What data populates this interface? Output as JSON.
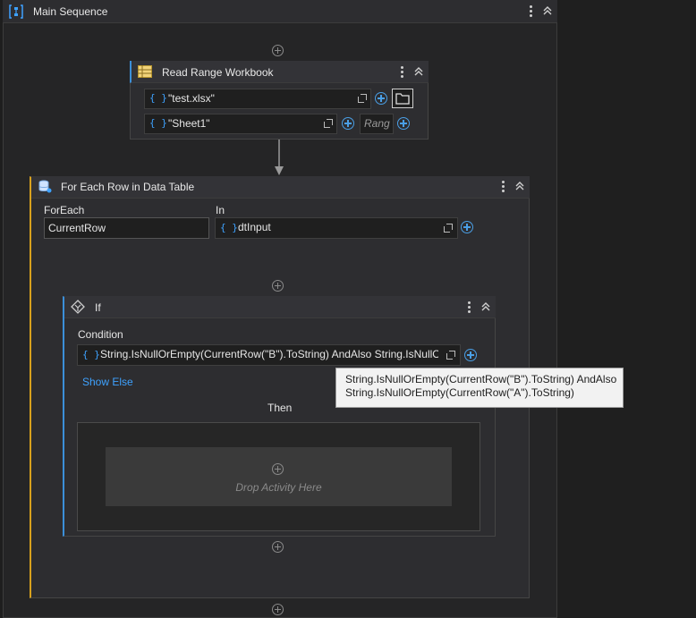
{
  "sequence": {
    "title": "Main Sequence"
  },
  "read_range": {
    "title": "Read Range Workbook",
    "workbook_path": "\"test.xlsx\"",
    "sheet_name": "\"Sheet1\"",
    "range_placeholder": "Rang"
  },
  "for_each": {
    "title": "For Each Row in Data Table",
    "foreach_label": "ForEach",
    "foreach_value": "CurrentRow",
    "in_label": "In",
    "in_value": "dtInput"
  },
  "if_activity": {
    "title": "If",
    "condition_label": "Condition",
    "condition_value": "String.IsNullOrEmpty(CurrentRow(\"B\").ToString) AndAlso String.IsNullO",
    "show_else": "Show Else",
    "then_label": "Then",
    "drop_hint": "Drop Activity Here"
  },
  "tooltip": {
    "line1": "String.IsNullOrEmpty(CurrentRow(\"B\").ToString) AndAlso",
    "line2": "String.IsNullOrEmpty(CurrentRow(\"A\").ToString)"
  },
  "colors": {
    "accent_blue": "#3ea2ff",
    "foreach_accent": "#d8a11d",
    "if_accent": "#3b8fd9"
  },
  "icons": {
    "sequence": "sequence-icon",
    "read_range": "excel-table-icon",
    "for_each": "database-icon",
    "if": "if-icon",
    "folder": "folder-icon"
  }
}
